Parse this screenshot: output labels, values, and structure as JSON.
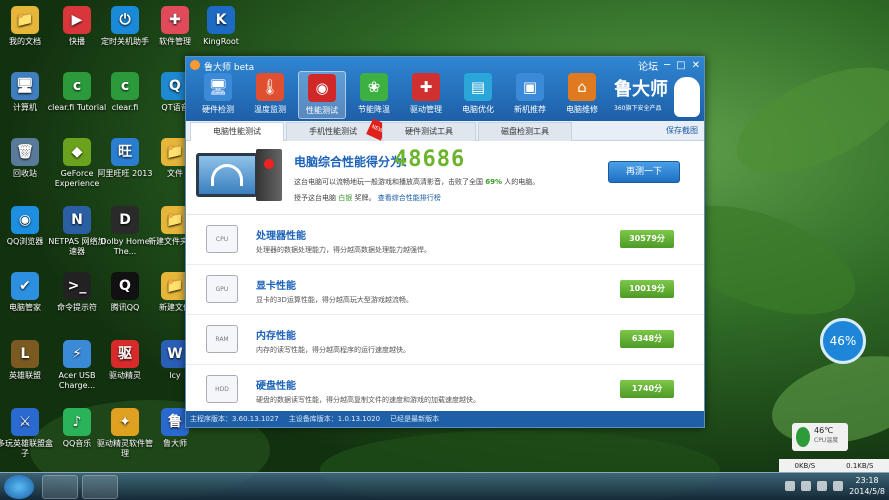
{
  "desktop": {
    "icons": [
      {
        "label": "我的文档",
        "glyph": "📁",
        "color": "#e6b63a"
      },
      {
        "label": "快播",
        "glyph": "▶",
        "color": "#d8363b"
      },
      {
        "label": "定时关机助手",
        "glyph": "⏻",
        "color": "#1a8ad8"
      },
      {
        "label": "软件管理",
        "glyph": "✚",
        "color": "#e04a5b"
      },
      {
        "label": "KingRoot",
        "glyph": "K",
        "color": "#1d6ac4"
      },
      {
        "label": "计算机",
        "glyph": "🖥",
        "color": "#3f7fbf"
      },
      {
        "label": "clear.fi Tutorial",
        "glyph": "c",
        "color": "#2c9a3a"
      },
      {
        "label": "clear.fi",
        "glyph": "c",
        "color": "#2c9a3a"
      },
      {
        "label": "QT语音",
        "glyph": "Q",
        "color": "#1e88d0"
      },
      {
        "label": "回收站",
        "glyph": "🗑",
        "color": "#5a7a9a"
      },
      {
        "label": "GeForce Experience",
        "glyph": "◆",
        "color": "#6aa21e"
      },
      {
        "label": "阿里旺旺 2013",
        "glyph": "旺",
        "color": "#2a7ed2"
      },
      {
        "label": "文件",
        "glyph": "📁",
        "color": "#e6b63a"
      },
      {
        "label": "QQ浏览器",
        "glyph": "◉",
        "color": "#1e8fe0"
      },
      {
        "label": "NETPAS 网络加速器",
        "glyph": "N",
        "color": "#2a5fa4"
      },
      {
        "label": "Dolby Home The...",
        "glyph": "D",
        "color": "#2a2a2a"
      },
      {
        "label": "新建文件夹 (2)",
        "glyph": "📁",
        "color": "#e6b63a"
      },
      {
        "label": "电脑管家",
        "glyph": "✔",
        "color": "#2d8fe0"
      },
      {
        "label": "命令提示符",
        "glyph": ">_",
        "color": "#222"
      },
      {
        "label": "腾讯QQ",
        "glyph": "Q",
        "color": "#111"
      },
      {
        "label": "新建文件",
        "glyph": "📁",
        "color": "#e6b63a"
      },
      {
        "label": "英雄联盟",
        "glyph": "L",
        "color": "#7a5a20"
      },
      {
        "label": "Acer USB Charge...",
        "glyph": "⚡",
        "color": "#3a8ad8"
      },
      {
        "label": "驱动精灵",
        "glyph": "驱",
        "color": "#d82a2a"
      },
      {
        "label": "lcy",
        "glyph": "W",
        "color": "#2a5fb8"
      },
      {
        "label": "多玩英雄联盟盒子",
        "glyph": "⚔",
        "color": "#2a6ad0"
      },
      {
        "label": "QQ音乐",
        "glyph": "♪",
        "color": "#2bb35a"
      },
      {
        "label": "驱动精灵软件管理",
        "glyph": "✦",
        "color": "#e0a020"
      },
      {
        "label": "鲁大师",
        "glyph": "鲁",
        "color": "#2a6ad0"
      }
    ]
  },
  "window": {
    "title": "鲁大师 beta",
    "links": [
      "论坛",
      "─",
      "□",
      "✕"
    ],
    "tools": [
      {
        "label": "硬件检测",
        "glyph": "🖥",
        "color": "#3a8ad8"
      },
      {
        "label": "温度监测",
        "glyph": "🌡",
        "color": "#e05030"
      },
      {
        "label": "性能测试",
        "glyph": "◉",
        "color": "#d02828"
      },
      {
        "label": "节能降温",
        "glyph": "❀",
        "color": "#3cb040"
      },
      {
        "label": "驱动管理",
        "glyph": "✚",
        "color": "#d03030"
      },
      {
        "label": "电脑优化",
        "glyph": "▤",
        "color": "#2aa7d8"
      },
      {
        "label": "新机推荐",
        "glyph": "▣",
        "color": "#3a8ad8"
      },
      {
        "label": "电脑维修",
        "glyph": "⌂",
        "color": "#e07a20"
      }
    ],
    "brand": {
      "name": "鲁大师",
      "sub": "360旗下安全产品"
    },
    "tabs": [
      "电脑性能测试",
      "手机性能测试",
      "硬件测试工具",
      "磁盘检测工具"
    ],
    "tab_badge": "NEW",
    "save_label": "保存截图",
    "summary": {
      "label": "电脑综合性能得分为：",
      "score": "48686",
      "line1_pre": "这台电脑可以流畅地玩一般游戏和播放高清影音，击败了全国",
      "line1_pct": "69%",
      "line1_post": "人的电脑。",
      "line2_pre": "授予这台电脑",
      "line2_award": "白银",
      "line2_mid": "奖牌。",
      "line2_link": "查看综合性能排行榜",
      "retest": "再测一下"
    },
    "rows": [
      {
        "title": "处理器性能",
        "desc": "处理器的数据处理能力，得分越高数据处理能力越强悍。",
        "score": "30579分",
        "icon": "CPU"
      },
      {
        "title": "显卡性能",
        "desc": "显卡的3D运算性能，得分越高玩大型游戏越流畅。",
        "score": "10019分",
        "icon": "GPU"
      },
      {
        "title": "内存性能",
        "desc": "内存的读写性能，得分越高程序的运行速度越快。",
        "score": "6348分",
        "icon": "RAM"
      },
      {
        "title": "硬盘性能",
        "desc": "硬盘的数据读写性能，得分越高复制文件的速度和游戏的加载速度越快。",
        "score": "1740分",
        "icon": "HDD"
      }
    ],
    "status": [
      "主程序版本：3.60.13.1027",
      "主设备库版本：1.0.13.1020",
      "已经是最新版本"
    ]
  },
  "widgets": {
    "ring": "46%",
    "temp": "46℃",
    "temp_label": "CPU温度",
    "net_down": "0KB/S",
    "net_up": "0.1KB/S"
  },
  "taskbar": {
    "time": "23:18",
    "date": "2014/5/8"
  }
}
